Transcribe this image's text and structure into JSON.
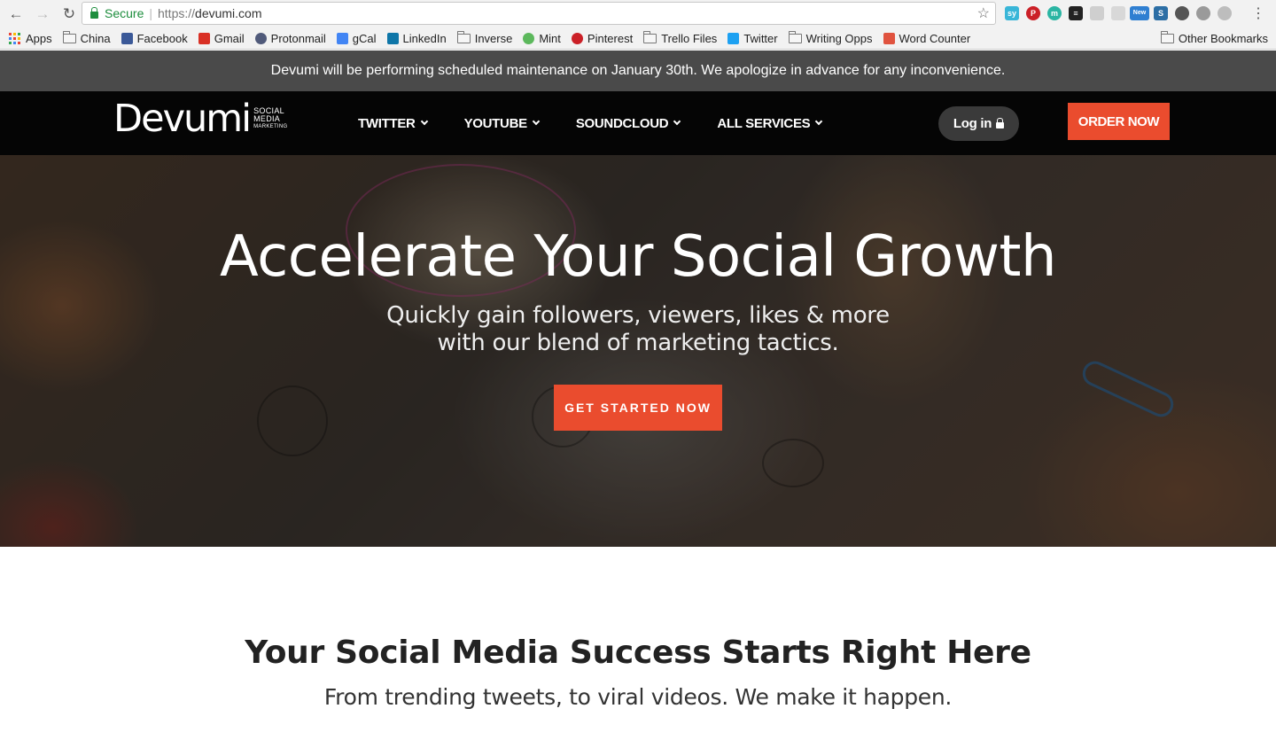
{
  "browser": {
    "security_label": "Secure",
    "url_scheme": "https://",
    "url_host": "devumi.com",
    "extensions": [
      {
        "name": "sy-extension-icon",
        "color": "#39b6d8",
        "text": "sy"
      },
      {
        "name": "pinterest-extension-icon",
        "color": "#cb2027",
        "text": "P"
      },
      {
        "name": "m-extension-icon",
        "color": "#2bb5a3",
        "text": "m"
      },
      {
        "name": "buffer-extension-icon",
        "color": "#222222",
        "text": "≡"
      },
      {
        "name": "cloud-extension-icon",
        "color": "#cfcfcf",
        "text": ""
      },
      {
        "name": "cast-extension-icon",
        "color": "#d8d8d8",
        "text": ""
      },
      {
        "name": "new-extension-icon",
        "color": "#2f7fd1",
        "text": "New"
      },
      {
        "name": "s-extension-icon",
        "color": "#2c6ea5",
        "text": "S"
      },
      {
        "name": "camera-extension-icon",
        "color": "#555555",
        "text": ""
      },
      {
        "name": "circle-extension-icon",
        "color": "#9a9a9a",
        "text": ""
      },
      {
        "name": "smile-extension-icon",
        "color": "#bdbdbd",
        "text": ""
      }
    ]
  },
  "bookmarks": {
    "items": [
      {
        "label": "Apps",
        "icon": "apps-grid-icon",
        "color": "#4285f4"
      },
      {
        "label": "China",
        "icon": "folder-icon",
        "color": "#777777"
      },
      {
        "label": "Facebook",
        "icon": "facebook-icon",
        "color": "#3b5998"
      },
      {
        "label": "Gmail",
        "icon": "gmail-icon",
        "color": "#d93025"
      },
      {
        "label": "Protonmail",
        "icon": "protonmail-icon",
        "color": "#505a7a"
      },
      {
        "label": "gCal",
        "icon": "google-calendar-icon",
        "color": "#4285f4"
      },
      {
        "label": "LinkedIn",
        "icon": "linkedin-icon",
        "color": "#0e76a8"
      },
      {
        "label": "Inverse",
        "icon": "folder-icon",
        "color": "#777777"
      },
      {
        "label": "Mint",
        "icon": "mint-leaf-icon",
        "color": "#5cb85c"
      },
      {
        "label": "Pinterest",
        "icon": "pinterest-icon",
        "color": "#cb2027"
      },
      {
        "label": "Trello Files",
        "icon": "folder-icon",
        "color": "#777777"
      },
      {
        "label": "Twitter",
        "icon": "twitter-bird-icon",
        "color": "#1da1f2"
      },
      {
        "label": "Writing Opps",
        "icon": "folder-icon",
        "color": "#777777"
      },
      {
        "label": "Word Counter",
        "icon": "word-counter-icon",
        "color": "#e0533f"
      }
    ],
    "other": "Other Bookmarks"
  },
  "notice": {
    "text": "Devumi will be performing scheduled maintenance on January 30th. We apologize in advance for any inconvenience."
  },
  "header": {
    "logo_word": "Devumi",
    "logo_sub_1": "SOCIAL",
    "logo_sub_2": "MEDIA",
    "logo_sub_3": "MARKETING",
    "nav": [
      "TWITTER",
      "YOUTUBE",
      "SOUNDCLOUD",
      "ALL SERVICES"
    ],
    "login": "Log in",
    "order": "ORDER NOW",
    "accent_color": "#ea4c2e"
  },
  "hero": {
    "title": "Accelerate Your Social Growth",
    "subtitle_line1": "Quickly gain followers, viewers, likes & more",
    "subtitle_line2": "with our blend of marketing tactics.",
    "cta": "GET STARTED NOW"
  },
  "section": {
    "title": "Your Social Media Success Starts Right Here",
    "subtitle": "From trending tweets, to viral videos. We make it happen."
  }
}
